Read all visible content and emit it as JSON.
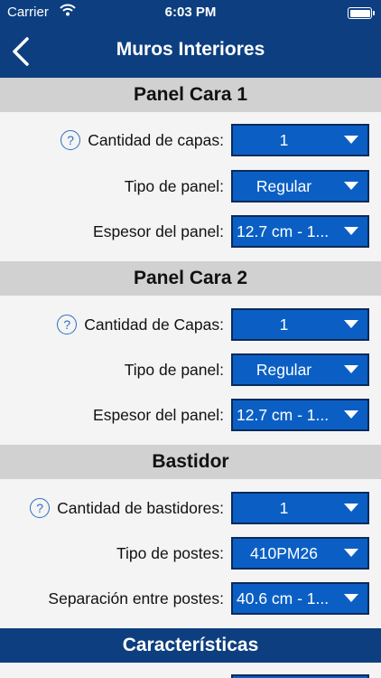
{
  "status_bar": {
    "carrier": "Carrier",
    "time": "6:03 PM"
  },
  "nav": {
    "title": "Muros Interiores"
  },
  "sections": {
    "panel1": {
      "title": "Panel Cara 1",
      "capas_label": "Cantidad de capas:",
      "capas_value": "1",
      "tipo_label": "Tipo de panel:",
      "tipo_value": "Regular",
      "espesor_label": "Espesor del panel:",
      "espesor_value": "12.7 cm - 1..."
    },
    "panel2": {
      "title": "Panel Cara 2",
      "capas_label": "Cantidad de Capas:",
      "capas_value": "1",
      "tipo_label": "Tipo de panel:",
      "tipo_value": "Regular",
      "espesor_label": "Espesor del panel:",
      "espesor_value": "12.7 cm - 1..."
    },
    "bastidor": {
      "title": "Bastidor",
      "cantidad_label": "Cantidad de bastidores:",
      "cantidad_value": "1",
      "postes_label": "Tipo de postes:",
      "postes_value": "410PM26",
      "separacion_label": "Separación entre postes:",
      "separacion_value": "40.6 cm - 1..."
    },
    "caracteristicas": {
      "title": "Características"
    }
  },
  "colors": {
    "navy": "#0d3f80",
    "select_blue": "#0b5fc4",
    "section_gray": "#d1d1d1",
    "help_blue": "#2d6dbf"
  }
}
